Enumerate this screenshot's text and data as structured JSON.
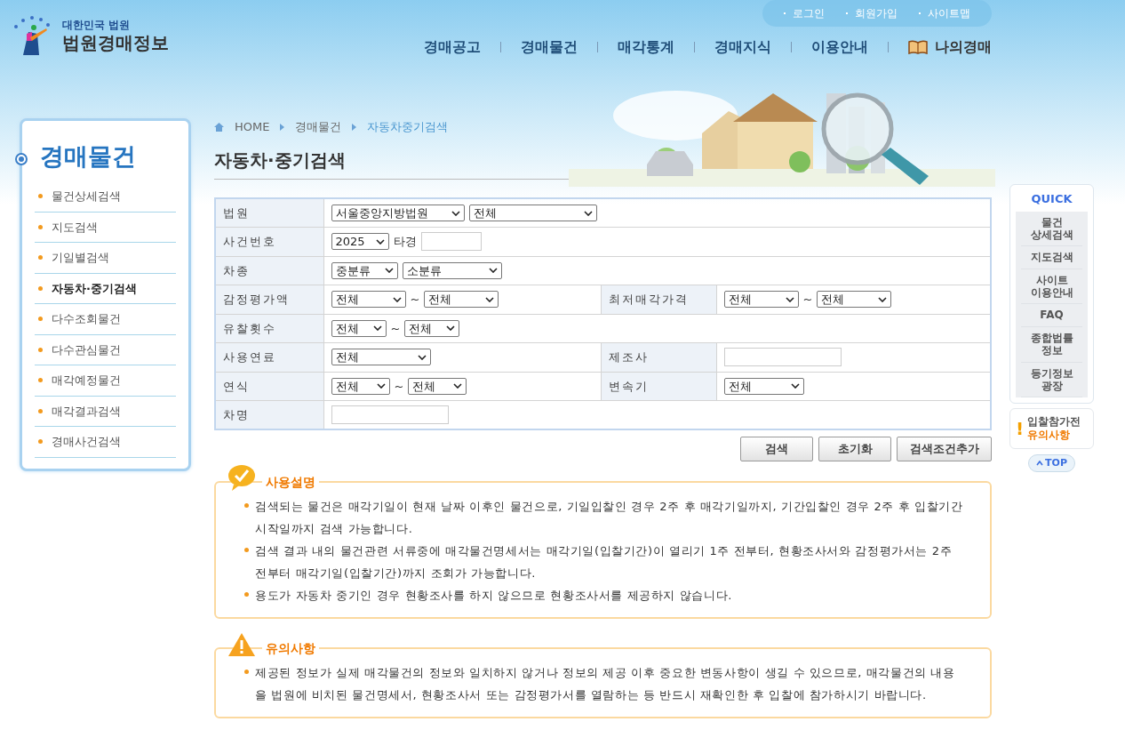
{
  "header": {
    "logo": {
      "top": "대한민국 법원",
      "main": "법원경매정보"
    },
    "util_links": [
      "로그인",
      "회원가입",
      "사이트맵"
    ],
    "nav": [
      {
        "label": "경매공고",
        "kind": "plain"
      },
      {
        "label": "경매물건",
        "kind": "plain"
      },
      {
        "label": "매각통계",
        "kind": "plain"
      },
      {
        "label": "경매지식",
        "kind": "plain"
      },
      {
        "label": "이용안내",
        "kind": "plain"
      },
      {
        "label": "나의경매",
        "kind": "book"
      }
    ]
  },
  "sidebar": {
    "title": "경매물건",
    "items": [
      {
        "label": "물건상세검색",
        "selected": false
      },
      {
        "label": "지도검색",
        "selected": false
      },
      {
        "label": "기일별검색",
        "selected": false
      },
      {
        "label": "자동차·중기검색",
        "selected": true
      },
      {
        "label": "다수조회물건",
        "selected": false
      },
      {
        "label": "다수관심물건",
        "selected": false
      },
      {
        "label": "매각예정물건",
        "selected": false
      },
      {
        "label": "매각결과검색",
        "selected": false
      },
      {
        "label": "경매사건검색",
        "selected": false
      }
    ]
  },
  "breadcrumb": [
    {
      "label": "HOME",
      "selected": false
    },
    {
      "label": "경매물건",
      "selected": false
    },
    {
      "label": "자동차중기검색",
      "selected": true
    }
  ],
  "page_title": "자동차·중기검색",
  "form": [
    {
      "label": "법원",
      "controls": [
        {
          "kind": "select",
          "value": "서울중앙지방법원"
        },
        {
          "kind": "select",
          "value": "전체"
        }
      ]
    },
    {
      "label": "사건번호",
      "controls": [
        {
          "kind": "select",
          "value": "2025"
        },
        {
          "kind": "text",
          "text": "타경"
        },
        {
          "kind": "input"
        }
      ]
    },
    {
      "label": "차종",
      "controls": [
        {
          "kind": "select",
          "value": "중분류"
        },
        {
          "kind": "select",
          "value": "소분류"
        }
      ]
    },
    {
      "label": "감정평가액",
      "controls": [
        {
          "kind": "select",
          "value": "전체"
        },
        {
          "kind": "text",
          "text": "~"
        },
        {
          "kind": "select",
          "value": "전체"
        }
      ],
      "extra": {
        "label": "최저매각가격",
        "controls": [
          {
            "kind": "select",
            "value": "전체"
          },
          {
            "kind": "text",
            "text": "~"
          },
          {
            "kind": "select",
            "value": "전체"
          }
        ]
      }
    },
    {
      "label": "유찰횟수",
      "controls": [
        {
          "kind": "select",
          "value": "전체"
        },
        {
          "kind": "text",
          "text": "~"
        },
        {
          "kind": "select",
          "value": "전체"
        }
      ]
    },
    {
      "label": "사용연료",
      "controls": [
        {
          "kind": "select",
          "value": "전체"
        }
      ],
      "extra": {
        "label": "제조사",
        "controls": [
          {
            "kind": "input"
          }
        ]
      }
    },
    {
      "label": "연식",
      "controls": [
        {
          "kind": "select",
          "value": "전체"
        },
        {
          "kind": "text",
          "text": "~"
        },
        {
          "kind": "select",
          "value": "전체"
        }
      ],
      "extra": {
        "label": "변속기",
        "controls": [
          {
            "kind": "select",
            "value": "전체"
          }
        ]
      }
    },
    {
      "label": "차명",
      "controls": [
        {
          "kind": "input"
        }
      ]
    }
  ],
  "buttons": [
    "검색",
    "초기화",
    "검색조건추가"
  ],
  "quick": {
    "title": "QUICK",
    "items": [
      [
        "물건",
        "상세검색"
      ],
      [
        "지도검색"
      ],
      [
        "사이트",
        "이용안내"
      ],
      [
        "FAQ"
      ],
      [
        "종합법률",
        "정보"
      ],
      [
        "등기정보",
        "광장"
      ]
    ]
  },
  "notice": {
    "mark": "!",
    "line1": "입찰참가전",
    "line2": "유의사항"
  },
  "top_button": "TOP",
  "sections": [
    {
      "kind": "check",
      "title": "사용설명",
      "items": [
        "검색되는 물건은 매각기일이 현재 날짜 이후인 물건으로, 기일입찰인 경우 2주 후 매각기일까지, 기간입찰인 경우 2주 후 입찰기간 시작일까지 검색 가능합니다.",
        "검색 결과 내의 물건관련 서류중에 매각물건명세서는 매각기일(입찰기간)이 열리기 1주 전부터, 현황조사서와 감정평가서는 2주 전부터 매각기일(입찰기간)까지 조회가 가능합니다.",
        "용도가 자동차 중기인 경우 현황조사를 하지 않으므로 현황조사서를 제공하지 않습니다."
      ]
    },
    {
      "kind": "warning",
      "title": "유의사항",
      "items": [
        "제공된 정보가 실제 매각물건의 정보와 일치하지 않거나 정보의 제공 이후 중요한 변동사항이 생길 수 있으므로, 매각물건의 내용을 법원에 비치된 물건명세서, 현황조사서 또는 감정평가서를 열람하는 등 반드시 재확인한 후 입찰에 참가하시기 바랍니다."
      ]
    }
  ]
}
